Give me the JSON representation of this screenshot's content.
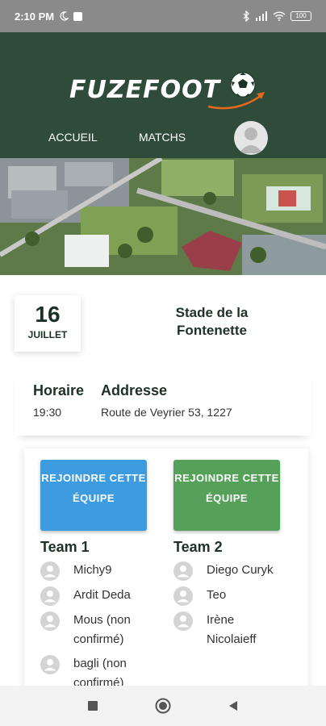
{
  "status_bar": {
    "time": "2:10 PM",
    "battery": "100",
    "icons": [
      "moon-icon",
      "notification-icon",
      "bluetooth-icon",
      "signal-icon",
      "wifi-icon",
      "battery-icon"
    ]
  },
  "header": {
    "logo_text": "FUZEFOOT",
    "nav": {
      "home": "ACCUEIL",
      "matches": "MATCHS"
    },
    "colors": {
      "background": "#2f4c3a",
      "logo_accent": "#e26a1a"
    }
  },
  "match": {
    "date": {
      "day": "16",
      "month": "JUILLET"
    },
    "stadium": "Stade de la Fontenette",
    "time_label": "Horaire",
    "time_value": "19:30",
    "address_label": "Addresse",
    "address_value": "Route de Veyrier 53, 1227"
  },
  "teams": [
    {
      "join_label": "REJOINDRE CETTE ÉQUIPE",
      "name": "Team 1",
      "button_color": "#3d9be0",
      "players": [
        "Michy9",
        "Ardit Deda",
        "Mous (non confirmé)",
        "bagli (non confirmé)"
      ]
    },
    {
      "join_label": "REJOINDRE CETTE ÉQUIPE",
      "name": "Team 2",
      "button_color": "#56a15a",
      "players": [
        "Diego Curyk",
        "Teo",
        "Irène Nicolaieff"
      ]
    }
  ],
  "system_nav": {
    "icons": [
      "recents-icon",
      "home-icon",
      "back-icon"
    ]
  }
}
